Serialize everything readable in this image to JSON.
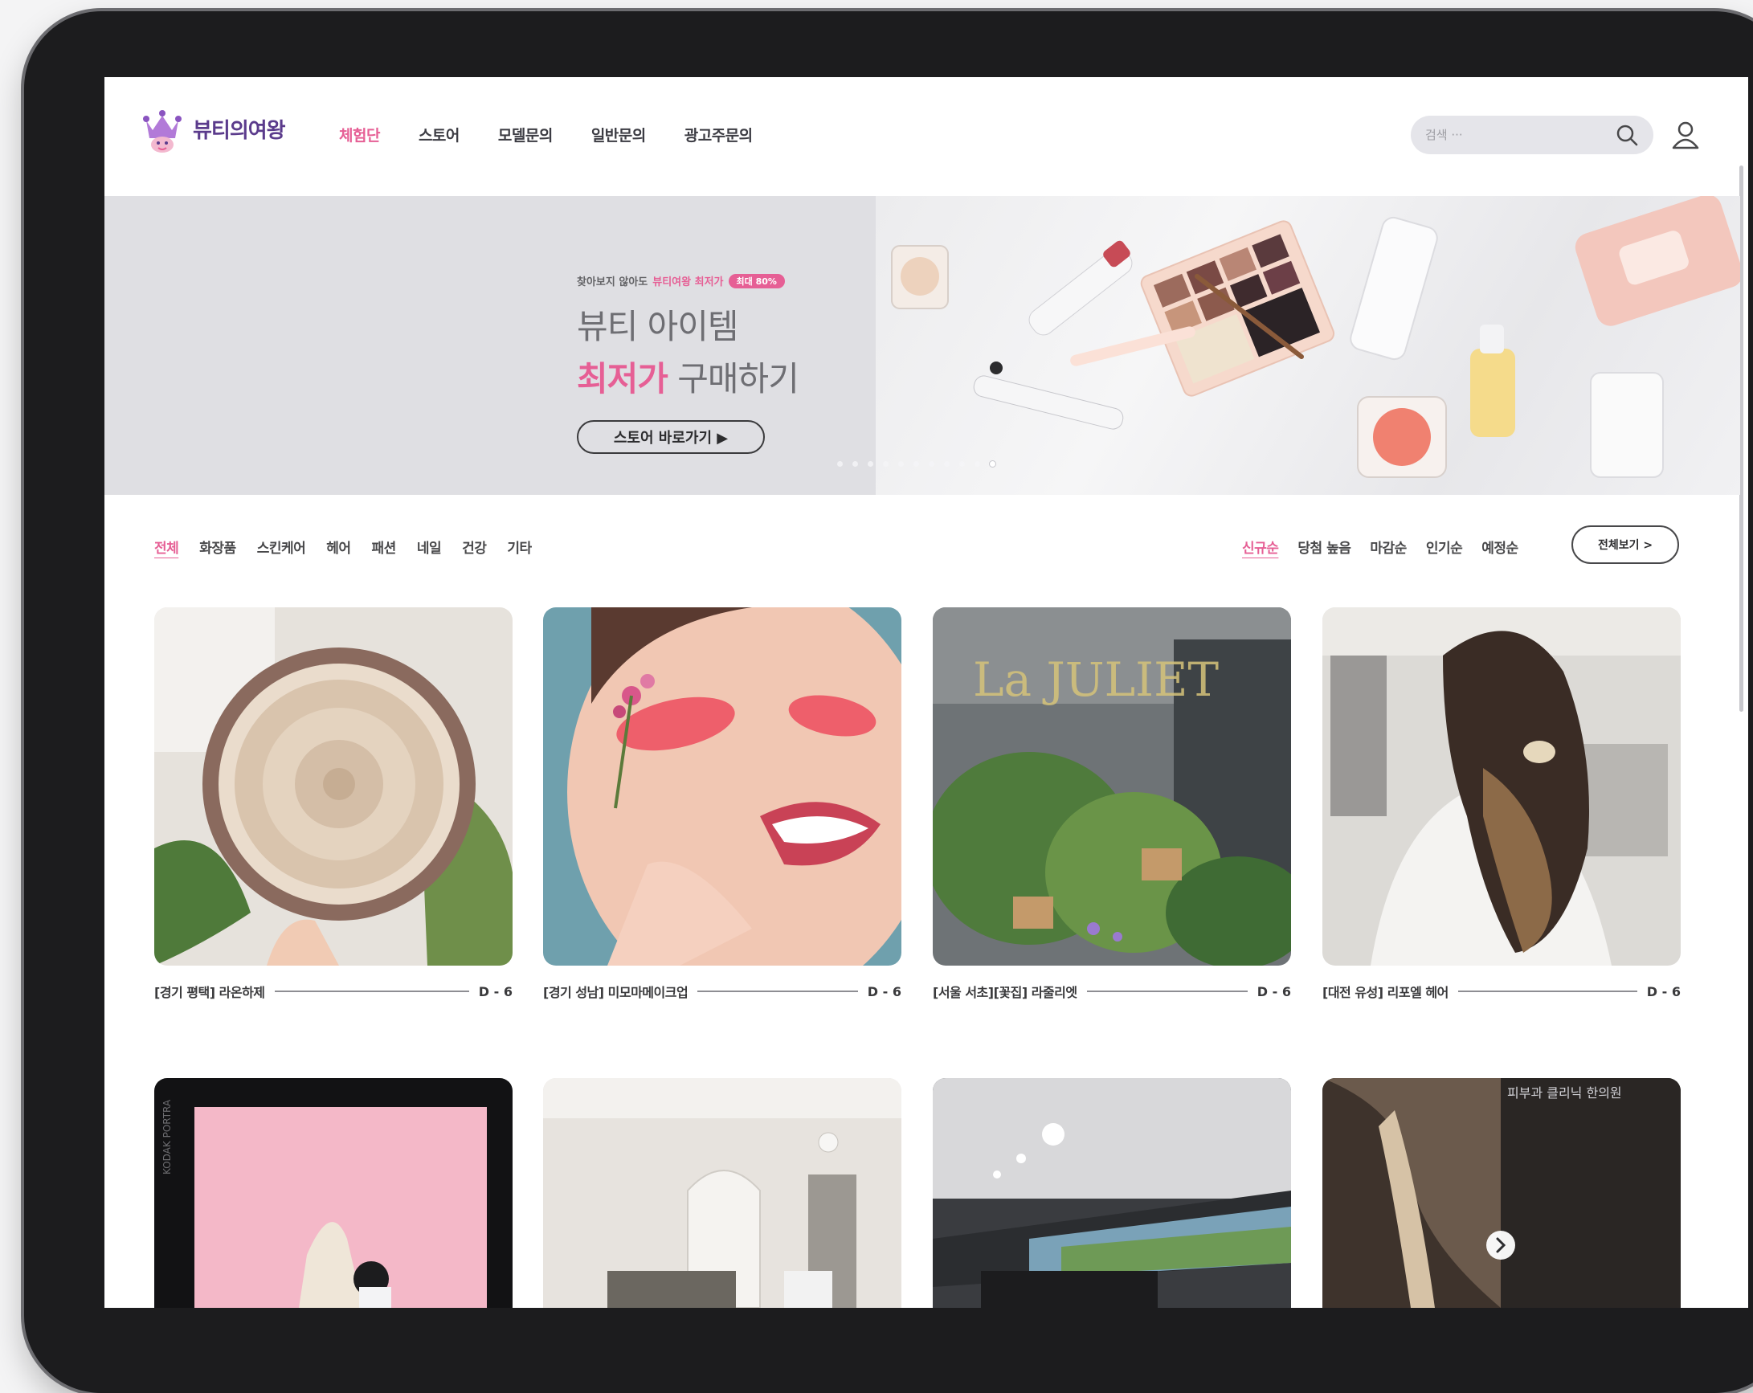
{
  "brand": {
    "name": "뷰티의여왕",
    "accent": "#e65f95",
    "logo_color": "#5b3b8c"
  },
  "nav": {
    "items": [
      "체험단",
      "스토어",
      "모델문의",
      "일반문의",
      "광고주문의"
    ],
    "active_index": 0
  },
  "search": {
    "placeholder": "검색 ···",
    "icon": "search-icon"
  },
  "user": {
    "icon": "user-icon"
  },
  "banner": {
    "eyebrow_prefix": "찾아보지 않아도",
    "eyebrow_highlight": "뷰티여왕 최저가",
    "eyebrow_badge": "최대 80%",
    "headline_line1": "뷰티 아이템",
    "headline_highlight": "최저가",
    "headline_rest": " 구매하기",
    "button_label": "스토어 바로가기 ▶",
    "slide_count": 11,
    "active_slide": 10
  },
  "categories": {
    "items": [
      "전체",
      "화장품",
      "스킨케어",
      "헤어",
      "패션",
      "네일",
      "건강",
      "기타"
    ],
    "active_index": 0
  },
  "sort": {
    "items": [
      "신규순",
      "당첨 높음",
      "마감순",
      "인기순",
      "예정순"
    ],
    "active_index": 0,
    "view_all_label": "전체보기 >"
  },
  "cards": [
    {
      "title": "[경기 평택] 라온하제",
      "dday": "D - 6",
      "image": "rattan-plate-photo"
    },
    {
      "title": "[경기 성남] 미모마메이크업",
      "dday": "D - 6",
      "image": "pink-makeup-portrait"
    },
    {
      "title": "[서울 서초][꽃집] 라줄리엣",
      "dday": "D - 6",
      "image": "flower-shop-window"
    },
    {
      "title": "[대전 유성] 리포엘 헤어",
      "dday": "D - 6",
      "image": "long-hair-salon"
    }
  ],
  "cards_row2": [
    {
      "image": "pink-studio-photo",
      "caption": "KODAK PORTRA"
    },
    {
      "image": "white-room-photo"
    },
    {
      "image": "screen-golf-photo"
    },
    {
      "image": "scalp-before-after",
      "caption": "피부과 클리닉 한의원"
    }
  ]
}
